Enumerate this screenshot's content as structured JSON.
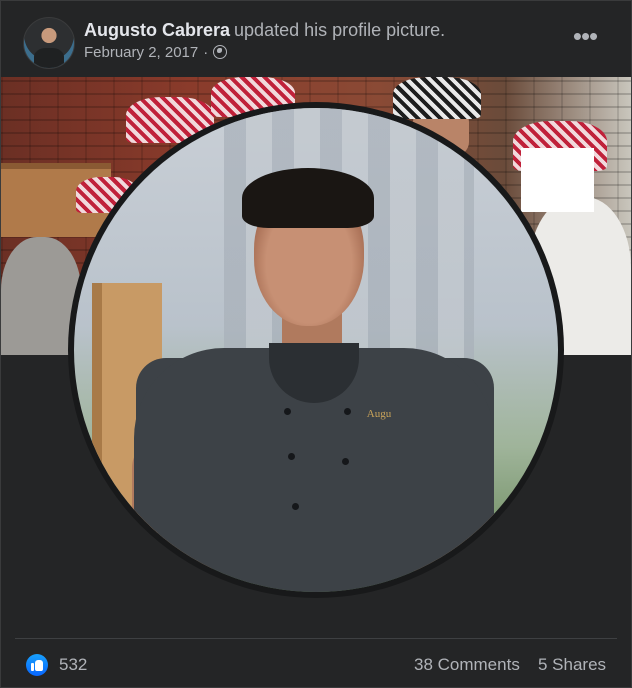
{
  "post": {
    "author_name": "Augusto Cabrera",
    "action_text": "updated his profile picture.",
    "date": "February 2, 2017",
    "separator": "·",
    "privacy_icon": "globe-icon",
    "more_icon": "more-options-icon",
    "more_glyph": "•••"
  },
  "profile_photo": {
    "logo_text": "Augu"
  },
  "reactions": {
    "icon": "like-icon",
    "count": "532"
  },
  "stats": {
    "comments": "38 Comments",
    "shares": "5 Shares"
  },
  "colors": {
    "background": "#18191a",
    "card": "#242526",
    "text_primary": "#e4e6eb",
    "text_secondary": "#b0b3b8",
    "like_blue": "#0866ff"
  }
}
